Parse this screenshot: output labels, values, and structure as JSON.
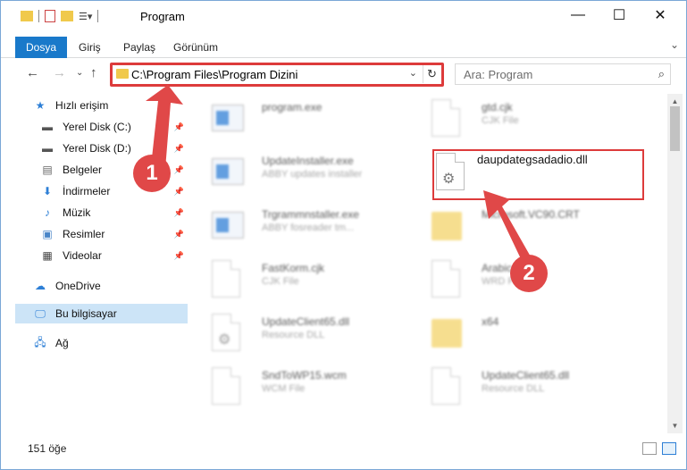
{
  "window": {
    "title": "Program"
  },
  "ribbon": {
    "tabs": [
      "Dosya",
      "Giriş",
      "Paylaş",
      "Görünüm"
    ]
  },
  "nav": {
    "address": "C:\\Program Files\\Program Dizini",
    "search_placeholder": "Ara: Program"
  },
  "sidebar": {
    "items": [
      {
        "label": "Hızlı erişim",
        "icon": "star-icon"
      },
      {
        "label": "Yerel Disk (C:)",
        "icon": "drive-icon",
        "pinned": true
      },
      {
        "label": "Yerel Disk (D:)",
        "icon": "drive-icon",
        "pinned": true
      },
      {
        "label": "Belgeler",
        "icon": "documents-icon",
        "pinned": true
      },
      {
        "label": "İndirmeler",
        "icon": "download-icon",
        "pinned": true
      },
      {
        "label": "Müzik",
        "icon": "music-icon",
        "pinned": true
      },
      {
        "label": "Resimler",
        "icon": "pictures-icon",
        "pinned": true
      },
      {
        "label": "Videolar",
        "icon": "videos-icon",
        "pinned": true
      },
      {
        "label": "OneDrive",
        "icon": "cloud-icon"
      },
      {
        "label": "Bu bilgisayar",
        "icon": "computer-icon",
        "selected": true
      },
      {
        "label": "Ağ",
        "icon": "network-icon"
      }
    ]
  },
  "files": {
    "left": [
      {
        "name": "program.exe",
        "type": ""
      },
      {
        "name": "UpdateInstaller.exe",
        "type": "ABBY updates installer"
      },
      {
        "name": "Trgrammnstaller.exe",
        "type": "ABBY fosreader tm..."
      },
      {
        "name": "FastKorm.cjk",
        "type": "CJK File"
      },
      {
        "name": "UpdateClient65.dll",
        "type": "Resource DLL"
      },
      {
        "name": "SndToWP15.wcm",
        "type": "WCM File"
      }
    ],
    "right": [
      {
        "name": "gtd.cjk",
        "type": "CJK File"
      },
      {
        "name": "daupdategsadadio.dll",
        "type": ""
      },
      {
        "name": "Microsoft.VC90.CRT",
        "type": ""
      },
      {
        "name": "Arabic",
        "type": "WRD File"
      },
      {
        "name": "x64",
        "type": ""
      },
      {
        "name": "UpdateClient65.dll",
        "type": "Resource DLL"
      }
    ]
  },
  "status": {
    "count": "151 öğe"
  },
  "markers": {
    "first": "1",
    "second": "2"
  },
  "colors": {
    "accent": "#1979ca",
    "highlight": "#dd3b3b"
  }
}
